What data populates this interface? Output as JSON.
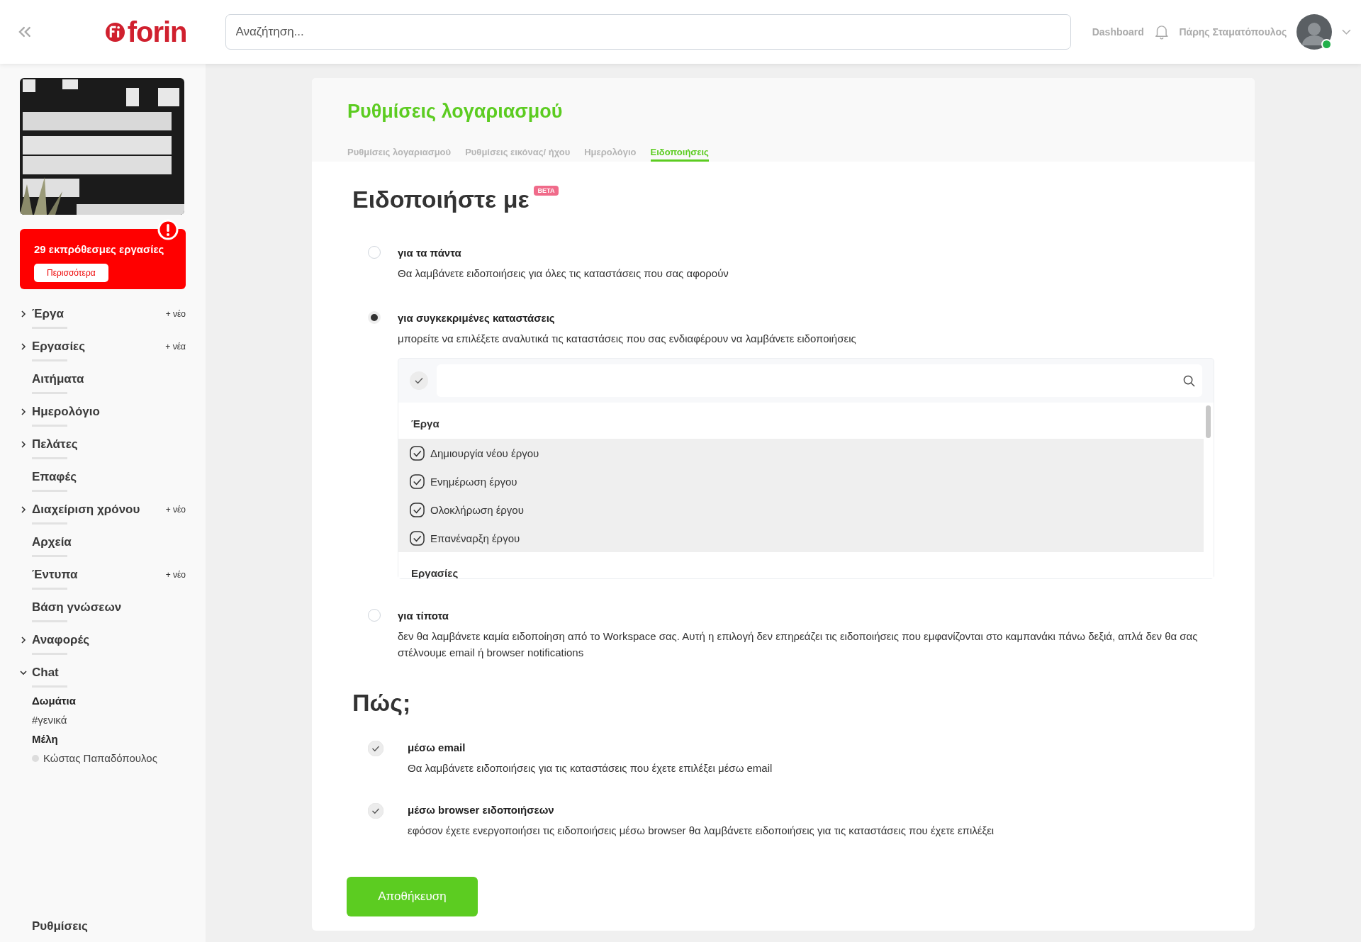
{
  "header": {
    "logo": "forin",
    "search": {
      "placeholder": "Αναζήτηση..."
    },
    "dashboard": "Dashboard",
    "user": {
      "name": "Πάρης Σταματόπουλος",
      "online": true
    }
  },
  "sidebar": {
    "alert": {
      "text": "29 εκπρόθεσμες εργασίες",
      "button": "Περισσότερα"
    },
    "items": [
      {
        "label": "Έργα",
        "kind": "group",
        "expanded": false,
        "add": "+ νέο"
      },
      {
        "label": "Εργασίες",
        "kind": "group",
        "expanded": false,
        "add": "+ νέα"
      },
      {
        "label": "Αιτήματα",
        "kind": "link"
      },
      {
        "label": "Ημερολόγιο",
        "kind": "group",
        "expanded": false
      },
      {
        "label": "Πελάτες",
        "kind": "group",
        "expanded": false
      },
      {
        "label": "Επαφές",
        "kind": "link"
      },
      {
        "label": "Διαχείριση χρόνου",
        "kind": "group",
        "expanded": false,
        "add": "+ νέο"
      },
      {
        "label": "Αρχεία",
        "kind": "link"
      },
      {
        "label": "Έντυπα",
        "kind": "link",
        "add": "+ νέο"
      },
      {
        "label": "Βάση γνώσεων",
        "kind": "link"
      },
      {
        "label": "Αναφορές",
        "kind": "group",
        "expanded": false
      },
      {
        "label": "Chat",
        "kind": "group",
        "expanded": true,
        "children": [
          {
            "heading": "Δωμάτια",
            "items": [
              {
                "name": "#γενικά",
                "kind": "room"
              }
            ]
          },
          {
            "heading": "Μέλη",
            "items": [
              {
                "name": "Κώστας Παπαδόπουλος",
                "kind": "member",
                "online": false
              }
            ]
          }
        ]
      }
    ],
    "footer": "Ρυθμίσεις"
  },
  "page": {
    "title": "Ρυθμίσεις λογαριασμού",
    "tabs": [
      {
        "label": "Ρυθμίσεις λογαριασμού",
        "selected": false
      },
      {
        "label": "Ρυθμίσεις εικόνας/ ήχου",
        "selected": false
      },
      {
        "label": "Ημερολόγιο",
        "selected": false
      },
      {
        "label": "Ειδοποιήσεις",
        "selected": true
      }
    ],
    "heading": "Ειδοποιήστε με",
    "badge": "BETA",
    "options": [
      {
        "label": "για τα πάντα",
        "description": "Θα λαμβάνετε ειδοποιήσεις για όλες τις καταστάσεις που σας αφορούν",
        "selected": false
      },
      {
        "label": "για συγκεκριμένες καταστάσεις",
        "description": "μπορείτε να επιλέξετε αναλυτικά τις καταστάσεις που σας ενδιαφέρουν να λαμβάνετε ειδοποιήσεις",
        "selected": true,
        "filter": {
          "groups": [
            {
              "heading": "Έργα",
              "items": [
                {
                  "label": "Δημιουργία νέου έργου",
                  "checked": true
                },
                {
                  "label": "Ενημέρωση έργου",
                  "checked": true
                },
                {
                  "label": "Ολοκλήρωση έργου",
                  "checked": true
                },
                {
                  "label": "Επανέναρξη έργου",
                  "checked": true
                }
              ]
            },
            {
              "heading": "Εργασίες"
            }
          ]
        }
      },
      {
        "label": "για τίποτα",
        "description": "δεν θα λαμβάνετε καμία ειδοποίηση από το Workspace σας. Αυτή η επιλογή δεν επηρεάζει τις ειδοποιήσεις που εμφανίζονται στο καμπανάκι πάνω δεξιά, απλά δεν θα σας στέλνουμε email ή browser notifications",
        "selected": false
      }
    ],
    "how": {
      "heading": "Πώς;",
      "items": [
        {
          "label": "μέσω email",
          "description": "Θα λαμβάνετε ειδοποιήσεις για τις καταστάσεις που έχετε επιλέξει μέσω email",
          "checked": true
        },
        {
          "label": "μέσω browser ειδοποιήσεων",
          "description": "εφόσον έχετε ενεργοποιήσει τις ειδοποιήσεις μέσω browser θα λαμβάνετε ειδοποιήσεις για τις καταστάσεις που έχετε επιλέξει",
          "checked": true
        }
      ]
    },
    "save_button": "Αποθήκευση"
  }
}
